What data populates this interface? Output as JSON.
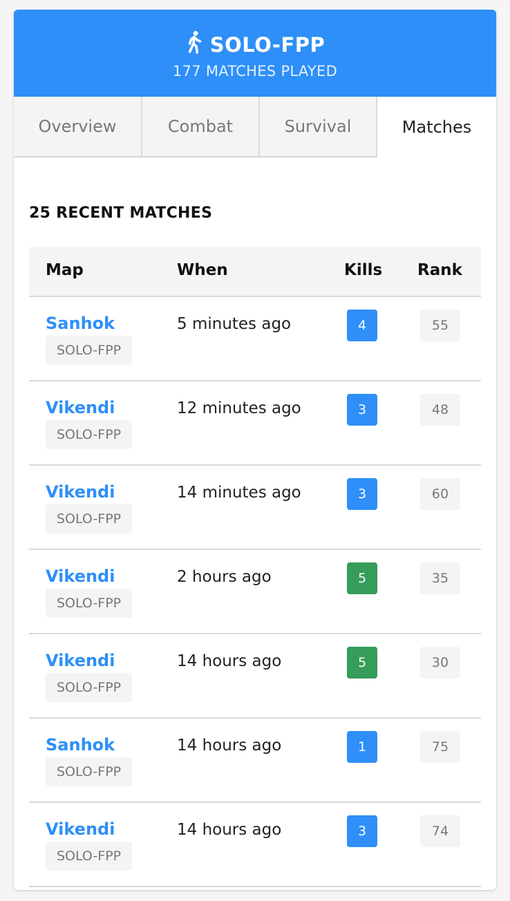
{
  "header": {
    "icon": "walking-person-icon",
    "title": "SOLO-FPP",
    "subtitle": "177 MATCHES PLAYED",
    "accent": "#2e8ff8"
  },
  "tabs": [
    {
      "label": "Overview",
      "active": false
    },
    {
      "label": "Combat",
      "active": false
    },
    {
      "label": "Survival",
      "active": false
    },
    {
      "label": "Matches",
      "active": true
    }
  ],
  "section_title": "25 RECENT MATCHES",
  "table": {
    "columns": [
      "Map",
      "When",
      "Kills",
      "Rank"
    ],
    "rows": [
      {
        "map": "Sanhok",
        "mode": "SOLO-FPP",
        "when": "5 minutes ago",
        "kills": "4",
        "kills_color": "#2e8ff8",
        "rank": "55"
      },
      {
        "map": "Vikendi",
        "mode": "SOLO-FPP",
        "when": "12 minutes ago",
        "kills": "3",
        "kills_color": "#2e8ff8",
        "rank": "48"
      },
      {
        "map": "Vikendi",
        "mode": "SOLO-FPP",
        "when": "14 minutes ago",
        "kills": "3",
        "kills_color": "#2e8ff8",
        "rank": "60"
      },
      {
        "map": "Vikendi",
        "mode": "SOLO-FPP",
        "when": "2 hours ago",
        "kills": "5",
        "kills_color": "#359c5a",
        "rank": "35"
      },
      {
        "map": "Vikendi",
        "mode": "SOLO-FPP",
        "when": "14 hours ago",
        "kills": "5",
        "kills_color": "#359c5a",
        "rank": "30"
      },
      {
        "map": "Sanhok",
        "mode": "SOLO-FPP",
        "when": "14 hours ago",
        "kills": "1",
        "kills_color": "#2e8ff8",
        "rank": "75"
      },
      {
        "map": "Vikendi",
        "mode": "SOLO-FPP",
        "when": "14 hours ago",
        "kills": "3",
        "kills_color": "#2e8ff8",
        "rank": "74"
      }
    ]
  }
}
